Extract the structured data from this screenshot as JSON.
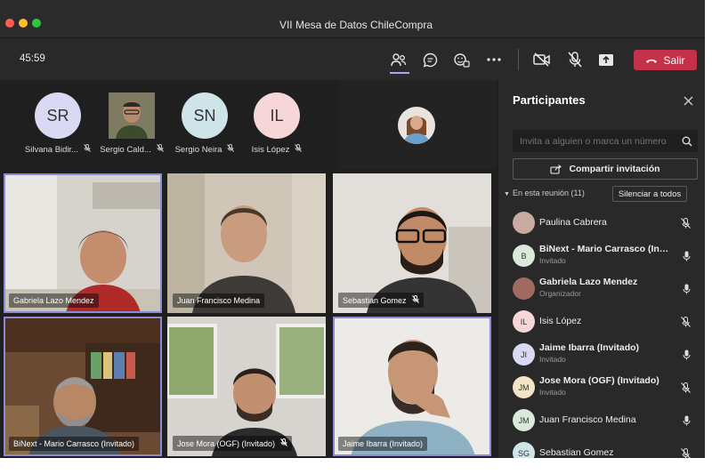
{
  "window": {
    "title": "VII Mesa de Datos ChileCompra"
  },
  "toolbar": {
    "timer": "45:59",
    "icons": [
      "people-icon",
      "chat-icon",
      "reactions-icon",
      "more-icon",
      "camera-off-icon",
      "mic-off-icon",
      "share-tray-icon",
      "phone-hangup-icon"
    ],
    "leave_label": "Salir",
    "leave_color": "#c4314b"
  },
  "hero_strip": [
    {
      "initials": "SR",
      "name": "Silvana Bidir...",
      "avatar_bg": "#d9d9f3",
      "avatar_fg": "#333"
    },
    {
      "initials": "",
      "name": "Sergio Cald...",
      "avatar_bg": "#6b6a55",
      "avatar_fg": "#fff"
    },
    {
      "initials": "SN",
      "name": "Sergio Neira",
      "avatar_bg": "#cfe4e9",
      "avatar_fg": "#333"
    },
    {
      "initials": "IL",
      "name": "Isis López",
      "avatar_bg": "#f6d6d6",
      "avatar_fg": "#333"
    }
  ],
  "video_tiles": [
    {
      "name": "Gabriela Lazo Mendez",
      "muted": false,
      "selected": true
    },
    {
      "name": "Juan Francisco Medina",
      "muted": false,
      "selected": false
    },
    {
      "name": "Sebastian Gomez",
      "muted": true,
      "selected": false
    },
    {
      "name": "BiNext - Mario Carrasco (Invitado)",
      "muted": false,
      "selected": true
    },
    {
      "name": "Jose Mora (OGF) (Invitado)",
      "muted": true,
      "selected": false
    },
    {
      "name": "Jaime Ibarra (Invitado)",
      "muted": false,
      "selected": true
    }
  ],
  "panel": {
    "title": "Participantes",
    "search_placeholder": "Invita a alguien o marca un número",
    "share_label": "Compartir invitación",
    "section_label": "En esta reunión (11)",
    "mute_all_label": "Silenciar a todos",
    "participants": [
      {
        "initials": "",
        "name": "Paulina Cabrera",
        "role": "",
        "muted": true,
        "avatar_bg": "#c9a9a0"
      },
      {
        "initials": "B",
        "name": "BiNext - Mario Carrasco (Invi...",
        "role": "Invitado",
        "muted": false,
        "avatar_bg": "#d9eadb"
      },
      {
        "initials": "",
        "name": "Gabriela Lazo Mendez",
        "role": "Organizador",
        "muted": false,
        "avatar_bg": "#a06a60"
      },
      {
        "initials": "IL",
        "name": "Isis López",
        "role": "",
        "muted": true,
        "avatar_bg": "#f6d6d6"
      },
      {
        "initials": "JI",
        "name": "Jaime Ibarra (Invitado)",
        "role": "Invitado",
        "muted": false,
        "avatar_bg": "#d9d9f3"
      },
      {
        "initials": "JM",
        "name": "Jose Mora (OGF) (Invitado)",
        "role": "Invitado",
        "muted": true,
        "avatar_bg": "#f3e4c6"
      },
      {
        "initials": "JM",
        "name": "Juan Francisco Medina",
        "role": "",
        "muted": false,
        "avatar_bg": "#d9eadb"
      },
      {
        "initials": "SG",
        "name": "Sebastian Gomez",
        "role": "",
        "muted": true,
        "avatar_bg": "#cfe4e9"
      }
    ]
  }
}
